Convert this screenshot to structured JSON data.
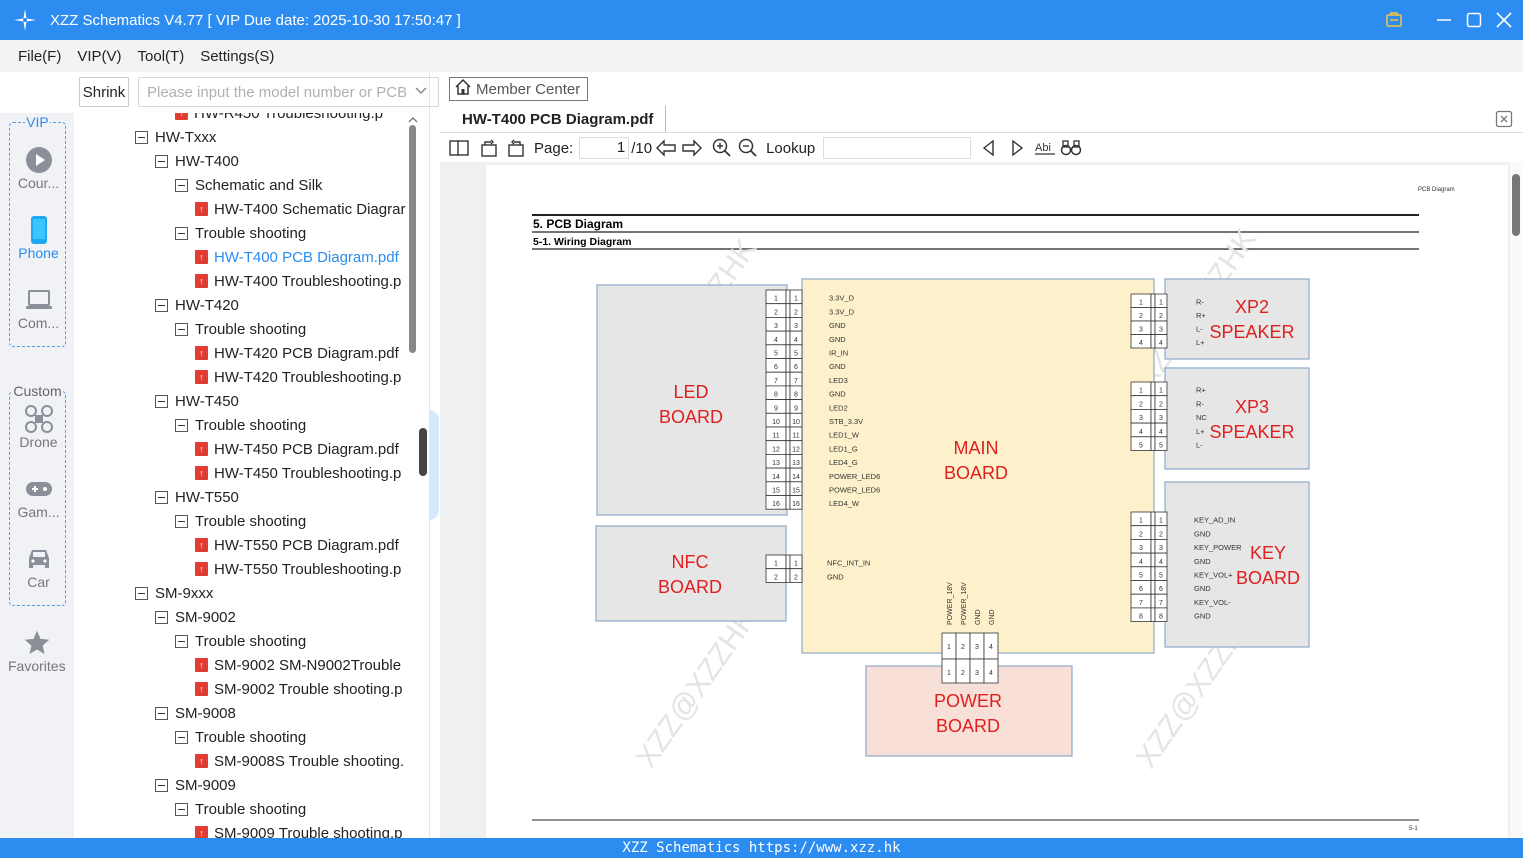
{
  "window": {
    "title": "XZZ Schematics V4.77 [ VIP Due date: 2025-10-30 17:50:47 ]"
  },
  "menu": [
    "File(F)",
    "VIP(V)",
    "Tool(T)",
    "Settings(S)"
  ],
  "search": {
    "shrink_label": "Shrink",
    "placeholder": "Please input the model number or PCB"
  },
  "nav": {
    "vip_group": "VIP",
    "custom_group": "Custom",
    "items": [
      {
        "label": "Cour...",
        "icon": "play-icon"
      },
      {
        "label": "Phone",
        "icon": "phone-icon"
      },
      {
        "label": "Com...",
        "icon": "laptop-icon"
      },
      {
        "label": "Drone",
        "icon": "drone-icon"
      },
      {
        "label": "Gam...",
        "icon": "gamepad-icon"
      },
      {
        "label": "Car",
        "icon": "car-icon"
      },
      {
        "label": "Favorites",
        "icon": "star-icon"
      }
    ]
  },
  "tree": [
    {
      "level": 3,
      "type": "pdf",
      "label": "HW-R450 Troubleshooting.p"
    },
    {
      "level": 1,
      "type": "folder",
      "label": "HW-Txxx"
    },
    {
      "level": 2,
      "type": "folder",
      "label": "HW-T400"
    },
    {
      "level": 3,
      "type": "folder",
      "label": "Schematic and Silk"
    },
    {
      "level": 4,
      "type": "pdf",
      "label": "HW-T400 Schematic Diagrar"
    },
    {
      "level": 3,
      "type": "folder",
      "label": "Trouble shooting"
    },
    {
      "level": 4,
      "type": "pdf",
      "label": "HW-T400 PCB Diagram.pdf",
      "selected": true
    },
    {
      "level": 4,
      "type": "pdf",
      "label": "HW-T400 Troubleshooting.p"
    },
    {
      "level": 2,
      "type": "folder",
      "label": "HW-T420"
    },
    {
      "level": 3,
      "type": "folder",
      "label": "Trouble shooting"
    },
    {
      "level": 4,
      "type": "pdf",
      "label": "HW-T420 PCB Diagram.pdf"
    },
    {
      "level": 4,
      "type": "pdf",
      "label": "HW-T420 Troubleshooting.p"
    },
    {
      "level": 2,
      "type": "folder",
      "label": "HW-T450"
    },
    {
      "level": 3,
      "type": "folder",
      "label": "Trouble shooting"
    },
    {
      "level": 4,
      "type": "pdf",
      "label": "HW-T450 PCB Diagram.pdf"
    },
    {
      "level": 4,
      "type": "pdf",
      "label": "HW-T450 Troubleshooting.p"
    },
    {
      "level": 2,
      "type": "folder",
      "label": "HW-T550"
    },
    {
      "level": 3,
      "type": "folder",
      "label": "Trouble shooting"
    },
    {
      "level": 4,
      "type": "pdf",
      "label": "HW-T550 PCB Diagram.pdf"
    },
    {
      "level": 4,
      "type": "pdf",
      "label": "HW-T550 Troubleshooting.p"
    },
    {
      "level": 1,
      "type": "folder",
      "label": "SM-9xxx"
    },
    {
      "level": 2,
      "type": "folder",
      "label": "SM-9002"
    },
    {
      "level": 3,
      "type": "folder",
      "label": "Trouble shooting"
    },
    {
      "level": 4,
      "type": "pdf",
      "label": "SM-9002 SM-N9002Trouble"
    },
    {
      "level": 4,
      "type": "pdf",
      "label": "SM-9002 Trouble shooting.p"
    },
    {
      "level": 2,
      "type": "folder",
      "label": "SM-9008"
    },
    {
      "level": 3,
      "type": "folder",
      "label": "Trouble shooting"
    },
    {
      "level": 4,
      "type": "pdf",
      "label": "SM-9008S Trouble shooting."
    },
    {
      "level": 2,
      "type": "folder",
      "label": "SM-9009"
    },
    {
      "level": 3,
      "type": "folder",
      "label": "Trouble shooting"
    },
    {
      "level": 4,
      "type": "pdf",
      "label": "SM-9009 Trouble shooting.p"
    }
  ],
  "viewer": {
    "member_center": "Member Center",
    "tab_title": "HW-T400 PCB Diagram.pdf",
    "page_label": "Page:",
    "page_current": "1",
    "page_total": "/10",
    "lookup_label": "Lookup"
  },
  "doc": {
    "header_tag": "PCB Diagram",
    "section": "5.  PCB Diagram",
    "subsection": "5-1.  Wiring Diagram",
    "watermark": "XZZ@XZZHK",
    "page_footer": "5-1",
    "boards": {
      "led": [
        "LED",
        "BOARD"
      ],
      "main": [
        "MAIN",
        "BOARD"
      ],
      "nfc": [
        "NFC",
        "BOARD"
      ],
      "power": [
        "POWER",
        "BOARD"
      ],
      "xp2": [
        "XP2",
        "SPEAKER"
      ],
      "xp3": [
        "XP3",
        "SPEAKER"
      ],
      "key": [
        "KEY",
        "BOARD"
      ]
    },
    "led_pins": [
      "3.3V_D",
      "3.3V_D",
      "GND",
      "GND",
      "IR_IN",
      "GND",
      "LED3",
      "GND",
      "LED2",
      "STB_3.3V",
      "LED1_W",
      "LED1_G",
      "LED4_G",
      "POWER_LED6",
      "POWER_LED6",
      "LED4_W"
    ],
    "xp2_pins": [
      "R-",
      "R+",
      "L-",
      "L+"
    ],
    "xp3_pins": [
      "R+",
      "R-",
      "NC",
      "L+",
      "L-"
    ],
    "key_pins": [
      "KEY_AD_IN",
      "GND",
      "KEY_POWER",
      "GND",
      "KEY_VOL+",
      "GND",
      "KEY_VOL-",
      "GND"
    ],
    "nfc_pins": [
      "NFC_INT_IN",
      "GND"
    ],
    "power_pins": [
      "POWER_18V",
      "POWER_18V",
      "GND",
      "GND"
    ]
  },
  "status": {
    "text": "XZZ Schematics https://www.xzz.hk"
  },
  "colors": {
    "accent": "#2d8cf0",
    "board_label": "#e02020",
    "main_board": "#fdf1cc",
    "power_board": "#f8e0d8",
    "board_gray": "#e6e6e6"
  }
}
